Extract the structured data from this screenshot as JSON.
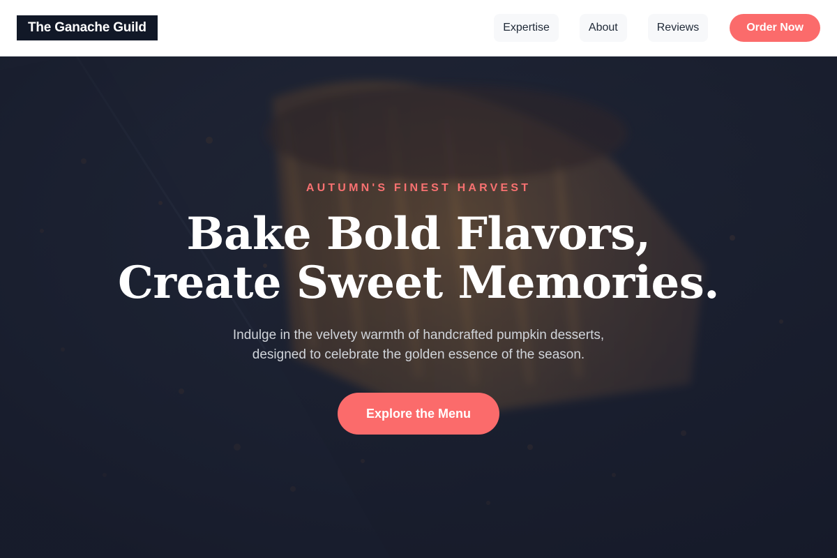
{
  "brand": {
    "name": "The Ganache Guild"
  },
  "nav": {
    "links": [
      {
        "label": "Expertise"
      },
      {
        "label": "About"
      },
      {
        "label": "Reviews"
      }
    ],
    "order_label": "Order Now"
  },
  "hero": {
    "eyebrow": "AUTUMN'S FINEST HARVEST",
    "headline_line1": "Bake Bold Flavors,",
    "headline_line2": "Create Sweet Memories.",
    "subtext_line1": "Indulge in the velvety warmth of handcrafted pumpkin desserts,",
    "subtext_line2": "designed to celebrate the golden essence of the season.",
    "cta_label": "Explore the Menu"
  },
  "colors": {
    "accent": "#fb6b6b",
    "logo_bg": "#111827",
    "overlay": "#1b2030"
  }
}
